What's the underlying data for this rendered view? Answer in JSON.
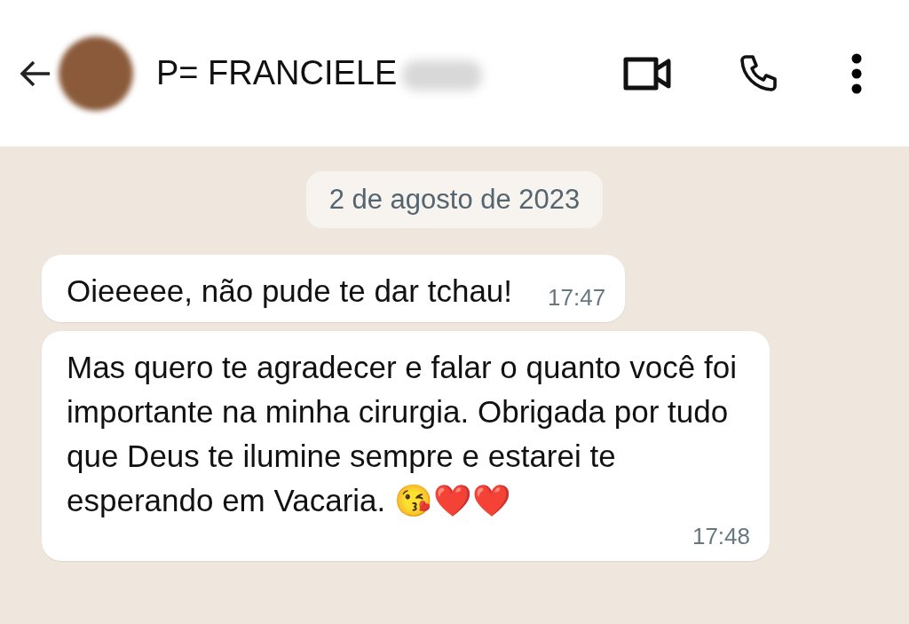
{
  "header": {
    "contact_name": "P= FRANCIELE"
  },
  "date_chip": "2 de agosto de 2023",
  "messages": [
    {
      "text": "Oieeeee, não pude te dar tchau!",
      "time": "17:47"
    },
    {
      "text": "Mas quero te agradecer e falar o quanto você foi importante na minha cirurgia. Obrigada por tudo que Deus te ilumine sempre e estarei te esperando em Vacaria. 😘❤️❤️",
      "time": "17:48"
    }
  ]
}
